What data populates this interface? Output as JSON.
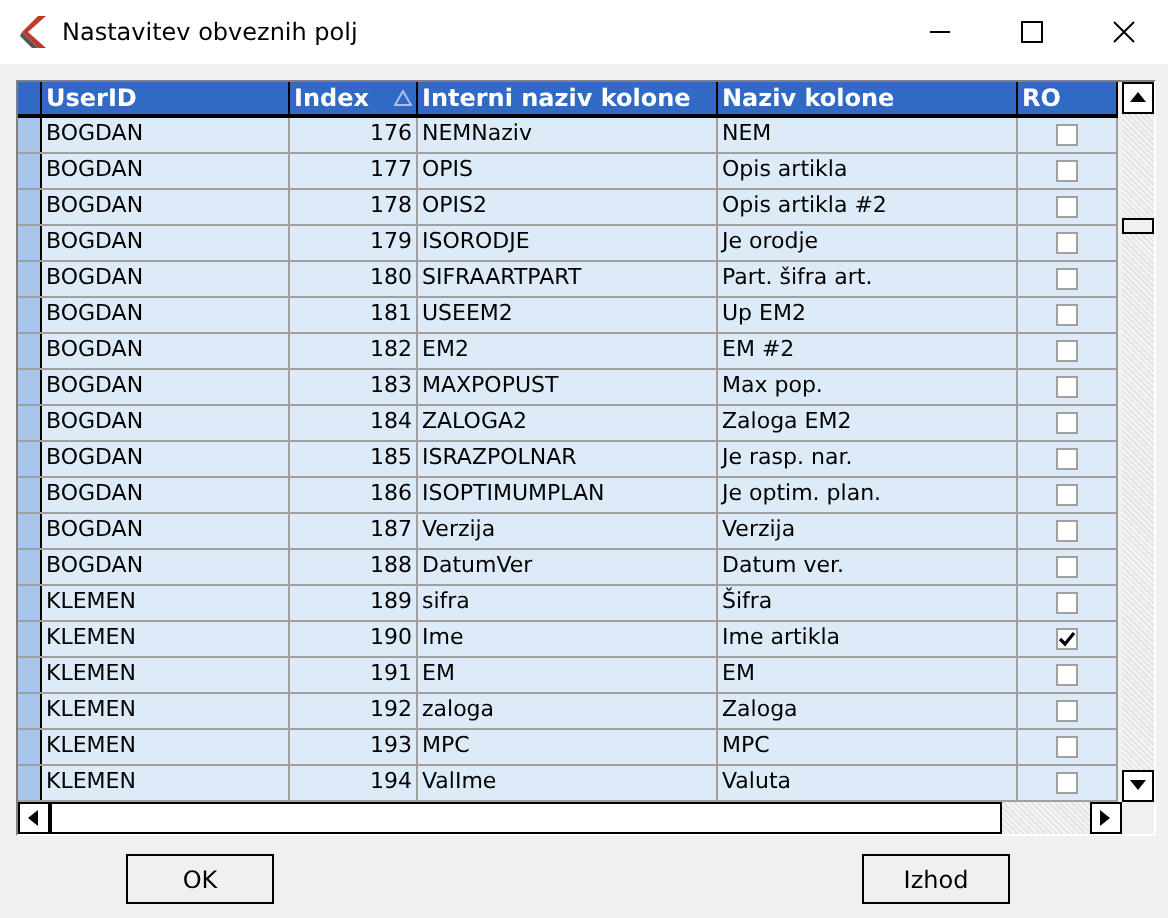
{
  "window": {
    "title": "Nastavitev obveznih polj"
  },
  "table": {
    "columns": [
      {
        "label": "UserID",
        "sorted": false
      },
      {
        "label": "Index",
        "sorted": true
      },
      {
        "label": "Interni naziv kolone",
        "sorted": false
      },
      {
        "label": "Naziv kolone",
        "sorted": false
      },
      {
        "label": "RO",
        "sorted": false
      }
    ],
    "rows": [
      {
        "user": "BOGDAN",
        "index": "176",
        "internal": "NEMNaziv",
        "name": "NEM",
        "ro": false
      },
      {
        "user": "BOGDAN",
        "index": "177",
        "internal": "OPIS",
        "name": "Opis artikla",
        "ro": false
      },
      {
        "user": "BOGDAN",
        "index": "178",
        "internal": "OPIS2",
        "name": "Opis artikla #2",
        "ro": false
      },
      {
        "user": "BOGDAN",
        "index": "179",
        "internal": "ISORODJE",
        "name": "Je orodje",
        "ro": false
      },
      {
        "user": "BOGDAN",
        "index": "180",
        "internal": "SIFRAARTPART",
        "name": "Part. šifra art.",
        "ro": false
      },
      {
        "user": "BOGDAN",
        "index": "181",
        "internal": "USEEM2",
        "name": "Up EM2",
        "ro": false
      },
      {
        "user": "BOGDAN",
        "index": "182",
        "internal": "EM2",
        "name": "EM #2",
        "ro": false
      },
      {
        "user": "BOGDAN",
        "index": "183",
        "internal": "MAXPOPUST",
        "name": "Max pop.",
        "ro": false
      },
      {
        "user": "BOGDAN",
        "index": "184",
        "internal": "ZALOGA2",
        "name": "Zaloga EM2",
        "ro": false
      },
      {
        "user": "BOGDAN",
        "index": "185",
        "internal": "ISRAZPOLNAR",
        "name": "Je rasp. nar.",
        "ro": false
      },
      {
        "user": "BOGDAN",
        "index": "186",
        "internal": "ISOPTIMUMPLAN",
        "name": "Je optim. plan.",
        "ro": false
      },
      {
        "user": "BOGDAN",
        "index": "187",
        "internal": "Verzija",
        "name": "Verzija",
        "ro": false
      },
      {
        "user": "BOGDAN",
        "index": "188",
        "internal": "DatumVer",
        "name": "Datum ver.",
        "ro": false
      },
      {
        "user": "KLEMEN",
        "index": "189",
        "internal": "sifra",
        "name": "Šifra",
        "ro": false
      },
      {
        "user": "KLEMEN",
        "index": "190",
        "internal": "Ime",
        "name": "Ime artikla",
        "ro": true
      },
      {
        "user": "KLEMEN",
        "index": "191",
        "internal": "EM",
        "name": "EM",
        "ro": false
      },
      {
        "user": "KLEMEN",
        "index": "192",
        "internal": "zaloga",
        "name": "Zaloga",
        "ro": false
      },
      {
        "user": "KLEMEN",
        "index": "193",
        "internal": "MPC",
        "name": "MPC",
        "ro": false
      },
      {
        "user": "KLEMEN",
        "index": "194",
        "internal": "ValIme",
        "name": "Valuta",
        "ro": false
      }
    ]
  },
  "buttons": [
    "OK",
    "Izhod"
  ]
}
